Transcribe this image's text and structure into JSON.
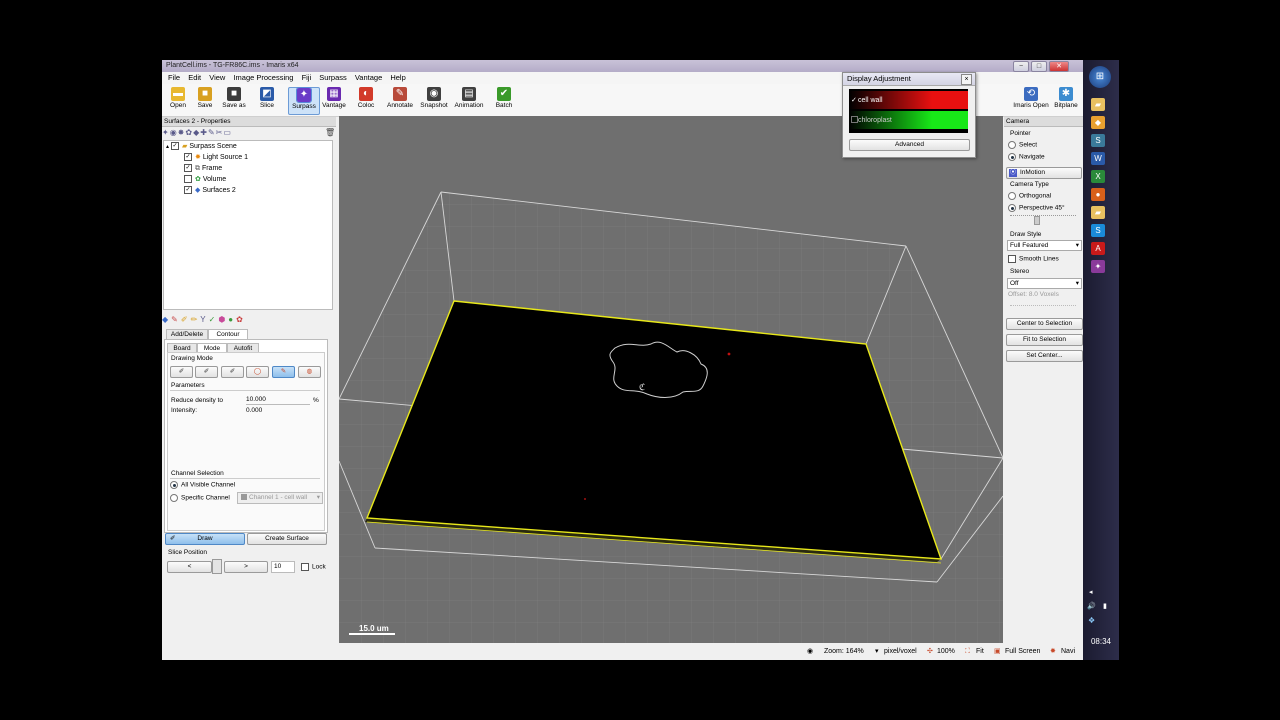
{
  "window": {
    "title": "PlantCell.ims - TG-FR86C.ims - Imaris x64",
    "controls": {
      "minimize": "−",
      "maximize": "□",
      "close": "✕"
    }
  },
  "menu": [
    "File",
    "Edit",
    "View",
    "Image Processing",
    "Fiji",
    "Surpass",
    "Vantage",
    "Help"
  ],
  "toolbar": {
    "left": [
      {
        "label": "Open",
        "icon": "folder-open-icon",
        "color": "#e8b830"
      },
      {
        "label": "Save",
        "icon": "save-icon",
        "color": "#3c3c3c"
      },
      {
        "label": "Save as",
        "icon": "save-as-icon",
        "color": "#3c3c3c"
      },
      {
        "label": "Slice",
        "icon": "slice-icon",
        "color": "#2a5aa8"
      },
      {
        "label": "Surpass",
        "icon": "surpass-icon",
        "color": "#6a3cc8"
      },
      {
        "label": "Vantage",
        "icon": "vantage-icon",
        "color": "#6a2ab0"
      },
      {
        "label": "Coloc",
        "icon": "coloc-icon",
        "color": "#d23a2a"
      },
      {
        "label": "Annotate",
        "icon": "annotate-icon",
        "color": "#b84a3a"
      },
      {
        "label": "Snapshot",
        "icon": "camera-icon",
        "color": "#404040"
      },
      {
        "label": "Animation",
        "icon": "film-icon",
        "color": "#404040"
      },
      {
        "label": "Batch",
        "icon": "batch-icon",
        "color": "#3a9a2a"
      }
    ],
    "right": [
      {
        "label": "Imaris Open",
        "icon": "imaris-open-icon",
        "color": "#3c6cc0"
      },
      {
        "label": "Bitplane",
        "icon": "bitplane-icon",
        "color": "#3c8cd0"
      }
    ]
  },
  "properties": {
    "header": "Surfaces 2 - Properties",
    "tree": [
      {
        "label": "Surpass Scene",
        "checked": true,
        "icon": "folder-icon",
        "level": 0
      },
      {
        "label": "Light Source 1",
        "checked": true,
        "icon": "light-icon",
        "level": 1
      },
      {
        "label": "Frame",
        "checked": true,
        "icon": "frame-icon",
        "level": 1
      },
      {
        "label": "Volume",
        "checked": false,
        "icon": "volume-icon",
        "level": 1
      },
      {
        "label": "Surfaces 2",
        "checked": true,
        "icon": "surfaces-icon",
        "level": 1
      }
    ]
  },
  "edit_panel": {
    "top_tabs": [
      "Add/Delete",
      "Contour"
    ],
    "sub_tabs": [
      "Board",
      "Mode",
      "Autofit"
    ],
    "drawing_mode_title": "Drawing Mode",
    "parameters_title": "Parameters",
    "reduce_density_label": "Reduce density to",
    "reduce_density_value": "10.000",
    "reduce_density_unit": "%",
    "intensity_label": "Intensity:",
    "intensity_value": "0.000",
    "channel_selection_title": "Channel Selection",
    "all_visible": "All Visible Channel",
    "specific": "Specific Channel",
    "channel_select": "Channel 1 - cell wall",
    "draw_button": "Draw",
    "create_surface_button": "Create Surface",
    "slice_position_title": "Slice Position",
    "prev": "<",
    "next": ">",
    "slice_value": "10",
    "lock_label": "Lock"
  },
  "display_adjustment": {
    "title": "Display Adjustment",
    "channels": [
      {
        "name": "cell wall",
        "checked": true,
        "color": "#e81010"
      },
      {
        "name": "chloroplast",
        "checked": false,
        "color": "#18e818"
      }
    ],
    "advanced": "Advanced"
  },
  "camera": {
    "header": "Camera",
    "pointer_title": "Pointer",
    "select": "Select",
    "navigate": "Navigate",
    "inmotion": "InMotion",
    "camera_type_title": "Camera Type",
    "orthogonal": "Orthogonal",
    "perspective": "Perspective 45°",
    "draw_style_title": "Draw Style",
    "draw_style_value": "Full Featured",
    "smooth_lines": "Smooth Lines",
    "stereo_title": "Stereo",
    "stereo_value": "Off",
    "offset_label": "Offset: 8.0 Voxels",
    "center_to_selection": "Center to Selection",
    "fit_to_selection": "Fit to Selection",
    "set_center": "Set Center..."
  },
  "viewport": {
    "scale_bar": "15.0 um",
    "background": "#6f6f6f",
    "frame_color": "#e8e81a"
  },
  "status": {
    "zoom": "Zoom: 164%",
    "unit": "pixel/voxel",
    "percent": "100%",
    "fit": "Fit",
    "fullscreen": "Full Screen",
    "navi": "Navi"
  },
  "taskbar": {
    "clock": "08:34"
  }
}
